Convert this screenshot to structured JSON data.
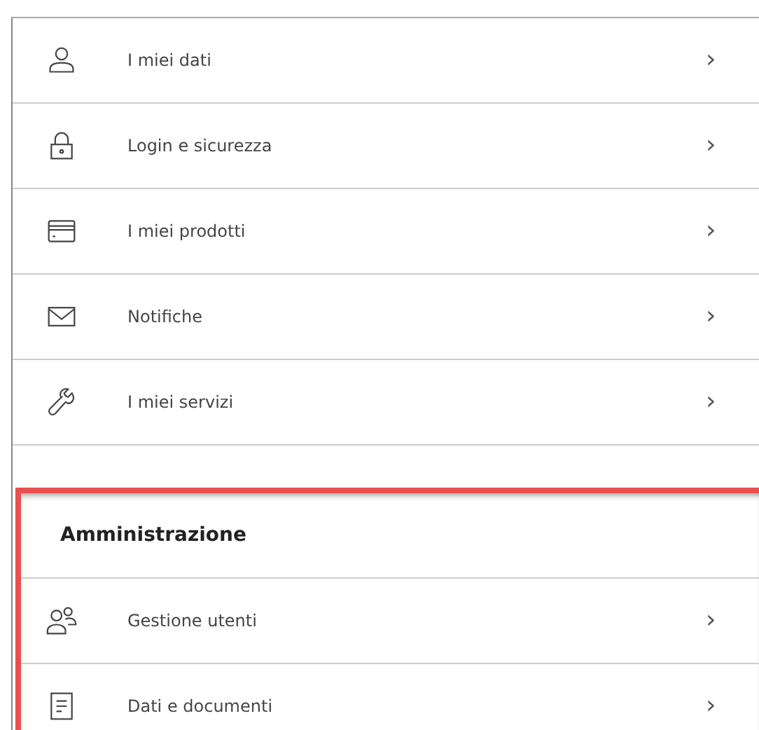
{
  "menu": {
    "items": [
      {
        "label": "I miei dati",
        "chevron": "›"
      },
      {
        "label": "Login e sicurezza",
        "chevron": "›"
      },
      {
        "label": "I miei prodotti",
        "chevron": "›"
      },
      {
        "label": "Notifiche",
        "chevron": "›"
      },
      {
        "label": "I miei servizi",
        "chevron": "›"
      }
    ]
  },
  "admin_section": {
    "title": "Amministrazione",
    "highlighted": true,
    "items": [
      {
        "label": "Gestione utenti",
        "chevron": "›"
      },
      {
        "label": "Dati e documenti",
        "chevron": "›"
      }
    ]
  }
}
